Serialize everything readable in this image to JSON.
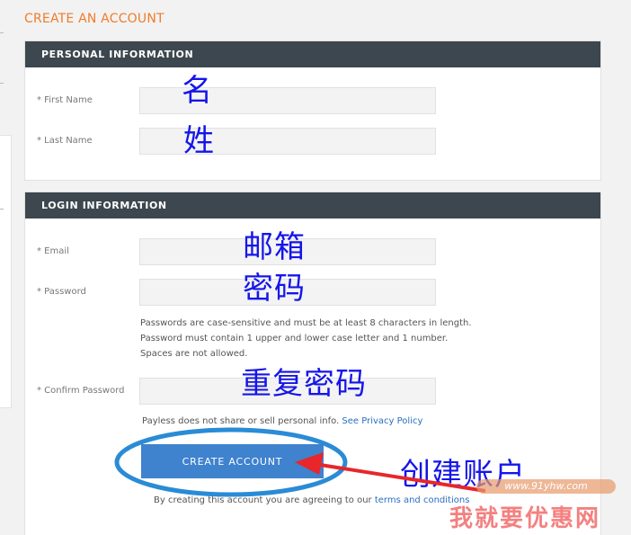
{
  "page": {
    "title": "CREATE AN ACCOUNT"
  },
  "personal": {
    "heading": "PERSONAL INFORMATION",
    "first_name_label": "* First Name",
    "first_name_value": "",
    "last_name_label": "* Last Name",
    "last_name_value": ""
  },
  "login": {
    "heading": "LOGIN INFORMATION",
    "email_label": "* Email",
    "email_value": "",
    "password_label": "* Password",
    "password_value": "",
    "password_rules": [
      "Passwords are case-sensitive and must be at least 8 characters in length.",
      "Password must contain 1 upper and lower case letter and 1 number.",
      "Spaces are not allowed."
    ],
    "confirm_label": "* Confirm Password",
    "confirm_value": "",
    "privacy_text": "Payless does not share or sell personal info. ",
    "privacy_link": "See Privacy Policy",
    "create_button": "CREATE ACCOUNT",
    "terms_text": "By creating this account you are agreeing to our ",
    "terms_link": "terms and conditions"
  },
  "annotations": {
    "first_name_cn": "名",
    "last_name_cn": "姓",
    "email_cn": "邮箱",
    "password_cn": "密码",
    "confirm_cn": "重复密码",
    "create_cn": "创建账户"
  },
  "watermark": {
    "text": "我就要优惠网",
    "url": "www.91yhw.com"
  },
  "colors": {
    "title_orange": "#f07c2b",
    "panel_header": "#3c474f",
    "button_blue": "#3f82ce",
    "annotation_blue": "#1515ea",
    "arrow_red": "#e8262b"
  }
}
